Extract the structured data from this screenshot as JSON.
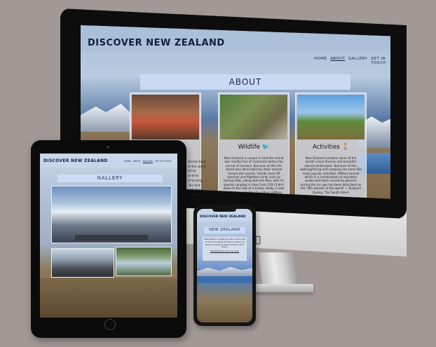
{
  "imac": {
    "site_title": "DISCOVER NEW ZEALAND",
    "nav": [
      {
        "label": "HOME",
        "active": false
      },
      {
        "label": "ABOUT",
        "active": true
      },
      {
        "label": "GALLERY",
        "active": false
      },
      {
        "label": "GET IN TOUCH",
        "active": false
      }
    ],
    "section_title": "ABOUT",
    "cards": [
      {
        "title": "",
        "body": ""
      },
      {
        "title": "Wildlife",
        "icon": "kiwi-icon",
        "body": "New Zealand is unique in that the island was mostly free of mammals before the arrival of humans. Because of this the island was dominated by other animal classes like insects, lizards (over 60 species) and flightless birds such as famous Kiwi, along with the Moa, with its species ranging in sizes from 12ft (3.6m) down to the size of a turkey. Sadly, it was hunted to extinction by native settlers."
      },
      {
        "title": "Activities",
        "icon": "hiker-icon",
        "body": "New Zealand contains some of the world's most diverse and beautiful natural landscapes. Because of this, walking/hiking and camping are some the most popular activities. Milford sounds which is a combination of mountain peaks and lakes carved by glaciers during the ice age has been described as the \"8th wonder of the world\" ~ Rudyard Kipling. The South Island"
      }
    ]
  },
  "ipad": {
    "site_title": "DISCOVER NEW ZEALAND",
    "nav": [
      {
        "label": "HOME",
        "active": false
      },
      {
        "label": "ABOUT",
        "active": false
      },
      {
        "label": "GALLERY",
        "active": true
      },
      {
        "label": "GET IN TOUCH",
        "active": false
      }
    ],
    "section_title": "GALLERY",
    "bleed_lines": [
      "stories back",
      "of the world.",
      "ed by",
      "re time",
      "of kinship",
      "The first",
      "ught New",
      "or Abel",
      "it was"
    ]
  },
  "iphone": {
    "site_title": "DISCOVER NEW ZEALAND",
    "section_title": "NEW ZEALAND",
    "card_text": "New Zealand is unlike any other country. Get to know more about its history, culture and people, and why so many choose to call it home.",
    "card_link": "Visit Zealand & chuck my home"
  }
}
